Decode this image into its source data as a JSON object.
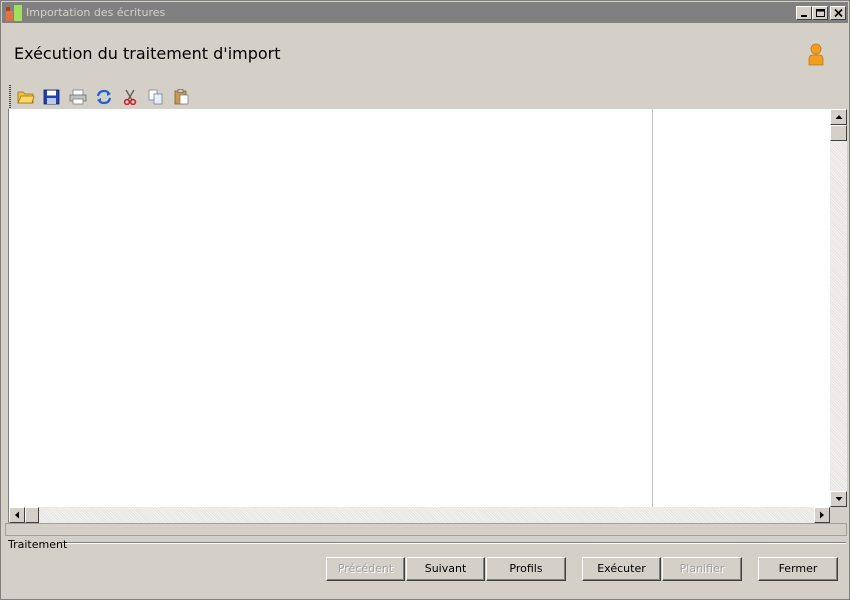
{
  "window": {
    "title": "Importation des écritures"
  },
  "header": {
    "title": "Exécution du traitement d'import"
  },
  "toolbar": {
    "items": [
      {
        "name": "open",
        "icon": "folder-open-icon"
      },
      {
        "name": "save",
        "icon": "floppy-disk-icon"
      },
      {
        "name": "print",
        "icon": "printer-icon"
      },
      {
        "name": "refresh",
        "icon": "refresh-icon"
      },
      {
        "name": "cut",
        "icon": "scissors-icon"
      },
      {
        "name": "copy",
        "icon": "copy-icon"
      },
      {
        "name": "paste",
        "icon": "clipboard-icon"
      }
    ]
  },
  "group": {
    "label": "Traitement"
  },
  "buttons": {
    "previous": "Précédent",
    "next": "Suivant",
    "profiles": "Profils",
    "execute": "Exécuter",
    "schedule": "Planifier",
    "close": "Fermer"
  },
  "colors": {
    "titlebar": "#808080",
    "face": "#d4d0c8",
    "user_icon": "#f0a020"
  }
}
